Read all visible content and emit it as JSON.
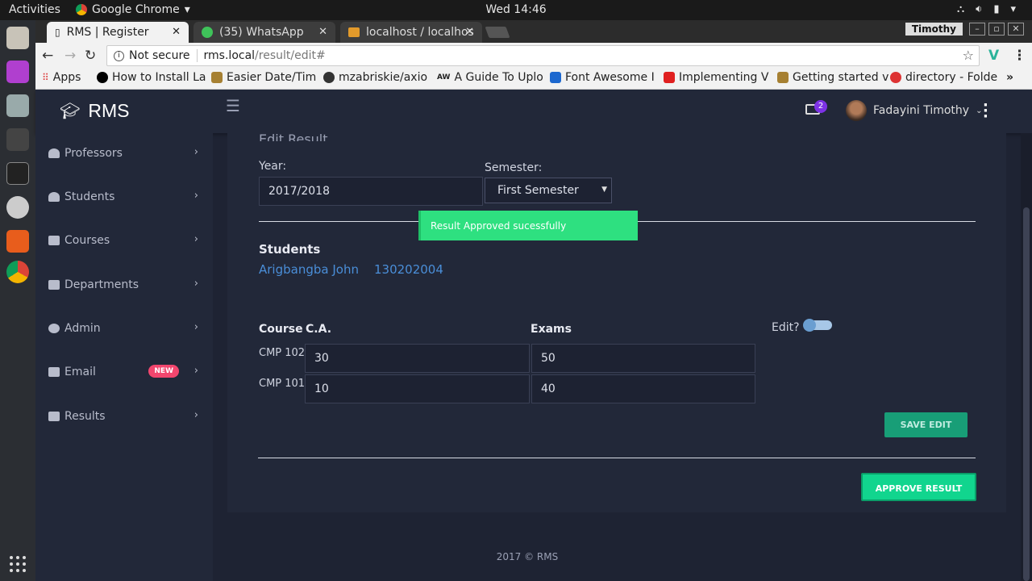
{
  "os": {
    "activities": "Activities",
    "app_name": "Google Chrome",
    "clock": "Wed 14:46",
    "user": "Timothy"
  },
  "tabs": [
    {
      "title": "RMS | Register"
    },
    {
      "title": "(35) WhatsApp"
    },
    {
      "title": "localhost / localhos"
    }
  ],
  "address": {
    "security": "Not secure",
    "host": "rms.local",
    "path": "/result/edit#"
  },
  "bookmarks": [
    {
      "label": "Apps",
      "color": "#d44"
    },
    {
      "label": "How to Install La",
      "color": "#000"
    },
    {
      "label": "Easier Date/Tim",
      "color": "#a68032"
    },
    {
      "label": "mzabriskie/axio",
      "color": "#333"
    },
    {
      "label": "A Guide To Uplo",
      "color": "#111"
    },
    {
      "label": "Font Awesome I",
      "color": "#1d68cf"
    },
    {
      "label": "Implementing V",
      "color": "#e02020"
    },
    {
      "label": "Getting started v",
      "color": "#a68032"
    },
    {
      "label": "directory - Folde",
      "color": "#d33"
    }
  ],
  "app": {
    "brand": "RMS",
    "header": {
      "mail_count": "2",
      "user_name": "Fadayini Timothy"
    },
    "sidebar": [
      {
        "label": "Professors"
      },
      {
        "label": "Students"
      },
      {
        "label": "Courses"
      },
      {
        "label": "Departments"
      },
      {
        "label": "Admin"
      },
      {
        "label": "Email",
        "badge": "NEW"
      },
      {
        "label": "Results"
      }
    ],
    "form": {
      "title": "Edit Result",
      "year_label": "Year:",
      "year_value": "2017/2018",
      "semester_label": "Semester:",
      "semester_value": "First Semester",
      "toast": "Result Approved sucessfully",
      "students_label": "Students",
      "student_name": "Arigbangba John",
      "student_id": "130202004",
      "col_course": "Course",
      "col_ca": "C.A.",
      "col_exams": "Exams",
      "edit_label": "Edit?",
      "rows": [
        {
          "course": "CMP 102",
          "ca": "30",
          "exam": "50"
        },
        {
          "course": "CMP 101",
          "ca": "10",
          "exam": "40"
        }
      ],
      "save_edit": "SAVE EDIT",
      "approve": "APPROVE RESULT"
    },
    "footer": "2017 © RMS"
  },
  "colors": {
    "accent": "#11d58e",
    "toast": "#2ee080",
    "link": "#4a8ed8",
    "badge": "#7d32e6",
    "new_badge": "#f2466e"
  }
}
